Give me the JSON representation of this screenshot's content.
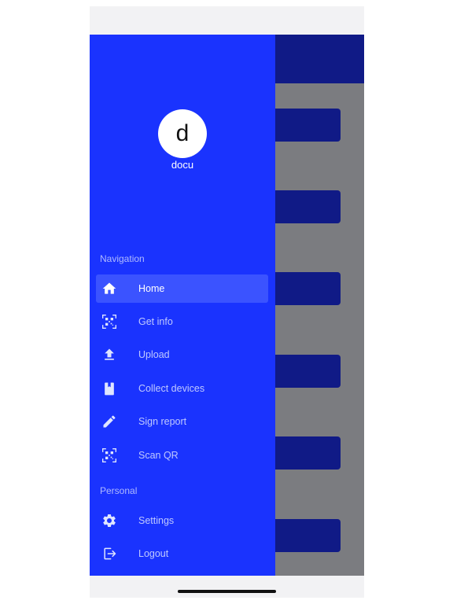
{
  "profile": {
    "avatar_letter": "d",
    "username": "docu"
  },
  "sections": {
    "navigation": "Navigation",
    "personal": "Personal"
  },
  "nav": {
    "home": {
      "label": "Home",
      "icon": "home-icon",
      "active": true
    },
    "get_info": {
      "label": "Get info",
      "icon": "qr-code-icon"
    },
    "upload": {
      "label": "Upload",
      "icon": "upload-icon"
    },
    "collect_devices": {
      "label": "Collect devices",
      "icon": "bookmark-icon"
    },
    "sign_report": {
      "label": "Sign report",
      "icon": "pencil-icon"
    },
    "scan_qr": {
      "label": "Scan QR",
      "icon": "qr-code-icon"
    },
    "settings": {
      "label": "Settings",
      "icon": "gear-icon"
    },
    "logout": {
      "label": "Logout",
      "icon": "logout-icon"
    }
  },
  "colors": {
    "drawer": "#1a33fe",
    "active_item": "#3b53ff",
    "app_dark": "#101a86",
    "overlay": "#7b7c80"
  }
}
